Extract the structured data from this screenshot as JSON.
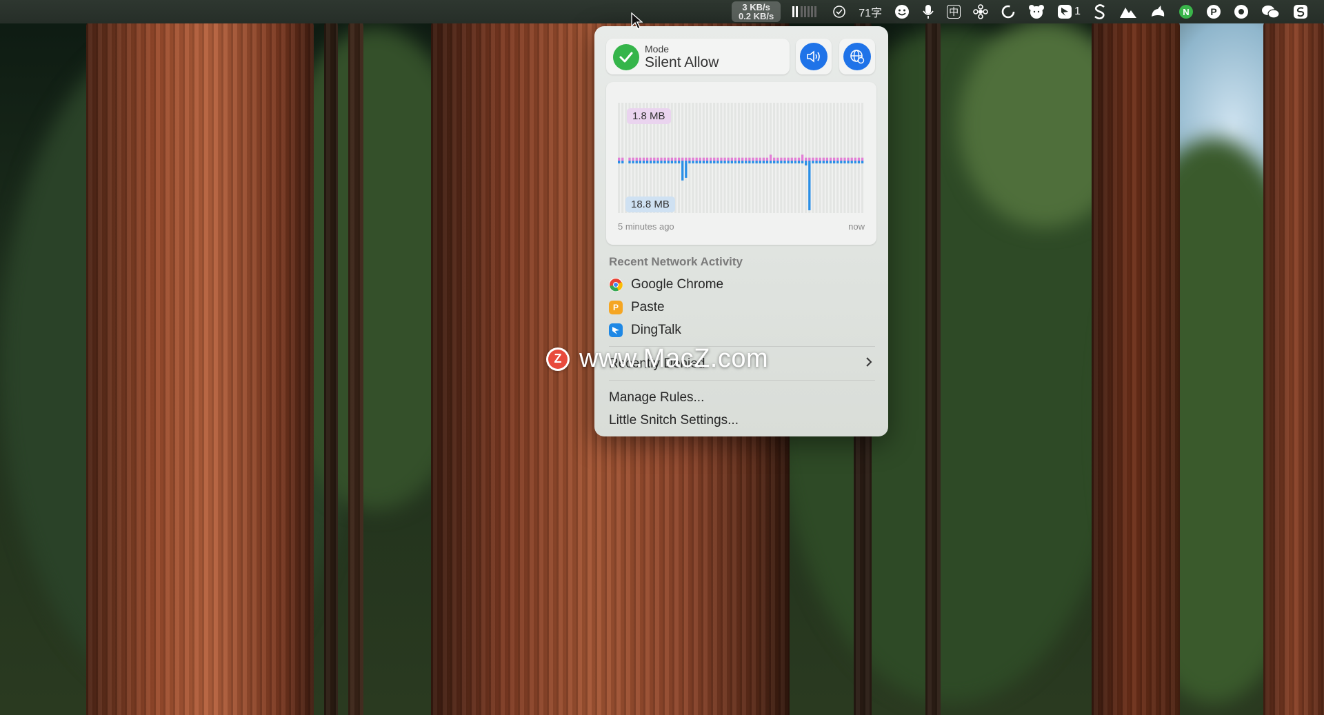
{
  "menubar": {
    "net_up": "3 KB/s",
    "net_down": "0.2 KB/s",
    "input_count": "71字",
    "input_method": "中",
    "badge_count": "1",
    "icons": [
      "signal-meter-icon",
      "checkmark-circle-icon",
      "face-icon",
      "microphone-icon",
      "input-method-icon",
      "flower-icon",
      "sync-icon",
      "bear-icon",
      "dingtalk-icon",
      "scrivener-icon",
      "mountain-icon",
      "bird-icon",
      "notion-icon",
      "paste-p-icon",
      "record-icon",
      "wechat-icon",
      "sketchbook-icon"
    ]
  },
  "popup": {
    "mode_label": "Mode",
    "mode_value": "Silent Allow",
    "chart_label_top": "1.8 MB",
    "chart_label_bottom": "18.8 MB",
    "time_left": "5 minutes ago",
    "time_right": "now",
    "recent_title": "Recent Network Activity",
    "apps": [
      {
        "name": "Google Chrome",
        "icon": "chrome-icon"
      },
      {
        "name": "Paste",
        "icon": "paste-icon"
      },
      {
        "name": "DingTalk",
        "icon": "dingtalk-icon"
      }
    ],
    "recently_denied": "Recently Denied",
    "manage_rules": "Manage Rules...",
    "settings": "Little Snitch Settings..."
  },
  "watermark": {
    "text": "www.MacZ.com",
    "badge": "Z"
  },
  "colors": {
    "accent_blue": "#1f73e8",
    "check_green": "#35b54a",
    "incoming": "#e27fd6",
    "outgoing": "#2a8fe6"
  },
  "chart_data": {
    "type": "bar",
    "series": [
      {
        "values": [
          0.1,
          0.1,
          0,
          0.1,
          0.1,
          0.1,
          0.1,
          0.1,
          0.1,
          0.1,
          0.1,
          0.1,
          0.1,
          0.1,
          0.1,
          0.1,
          0.1,
          0.1,
          0.1,
          0.1,
          0.1,
          0.1,
          0.1,
          0.1,
          0.1,
          0.1,
          0.1,
          0.1,
          0.1,
          0.1,
          0.1,
          0.1,
          0.1,
          0.1,
          0.1,
          0.1,
          0.1,
          0.1,
          0.1,
          0.1,
          0.1,
          0.1,
          0.1,
          0.2,
          0.1,
          0.1,
          0.1,
          0.1,
          0.1,
          0.1,
          0.1,
          0.1,
          0.2,
          0.1,
          0.1,
          0.1,
          0.1,
          0.1,
          0.1,
          0.1,
          0.1,
          0.1,
          0.1,
          0.1,
          0.1,
          0.1,
          0.1,
          0.1,
          0.1,
          0.1
        ]
      },
      {
        "values": [
          0.3,
          0.3,
          0,
          0.3,
          0.3,
          0.3,
          0.3,
          0.3,
          0.3,
          0.3,
          0.3,
          0.3,
          0.3,
          0.3,
          0.3,
          0.3,
          0.3,
          0.3,
          7.5,
          6.5,
          0.3,
          0.3,
          0.3,
          0.3,
          0.3,
          0.3,
          0.3,
          0.3,
          0.3,
          0.3,
          0.3,
          0.3,
          0.3,
          0.3,
          0.3,
          0.3,
          0.3,
          0.3,
          0.3,
          0.3,
          0.3,
          0.3,
          0.3,
          0.6,
          0.3,
          0.3,
          0.3,
          0.3,
          0.3,
          0.6,
          0.9,
          0.9,
          0.3,
          1.8,
          18.8,
          0.3,
          0.3,
          0.3,
          0.3,
          0.3,
          0.3,
          0.3,
          0.3,
          0.3,
          0.3,
          0.3,
          0.3,
          0.3,
          0.3,
          0.3
        ]
      }
    ]
  }
}
